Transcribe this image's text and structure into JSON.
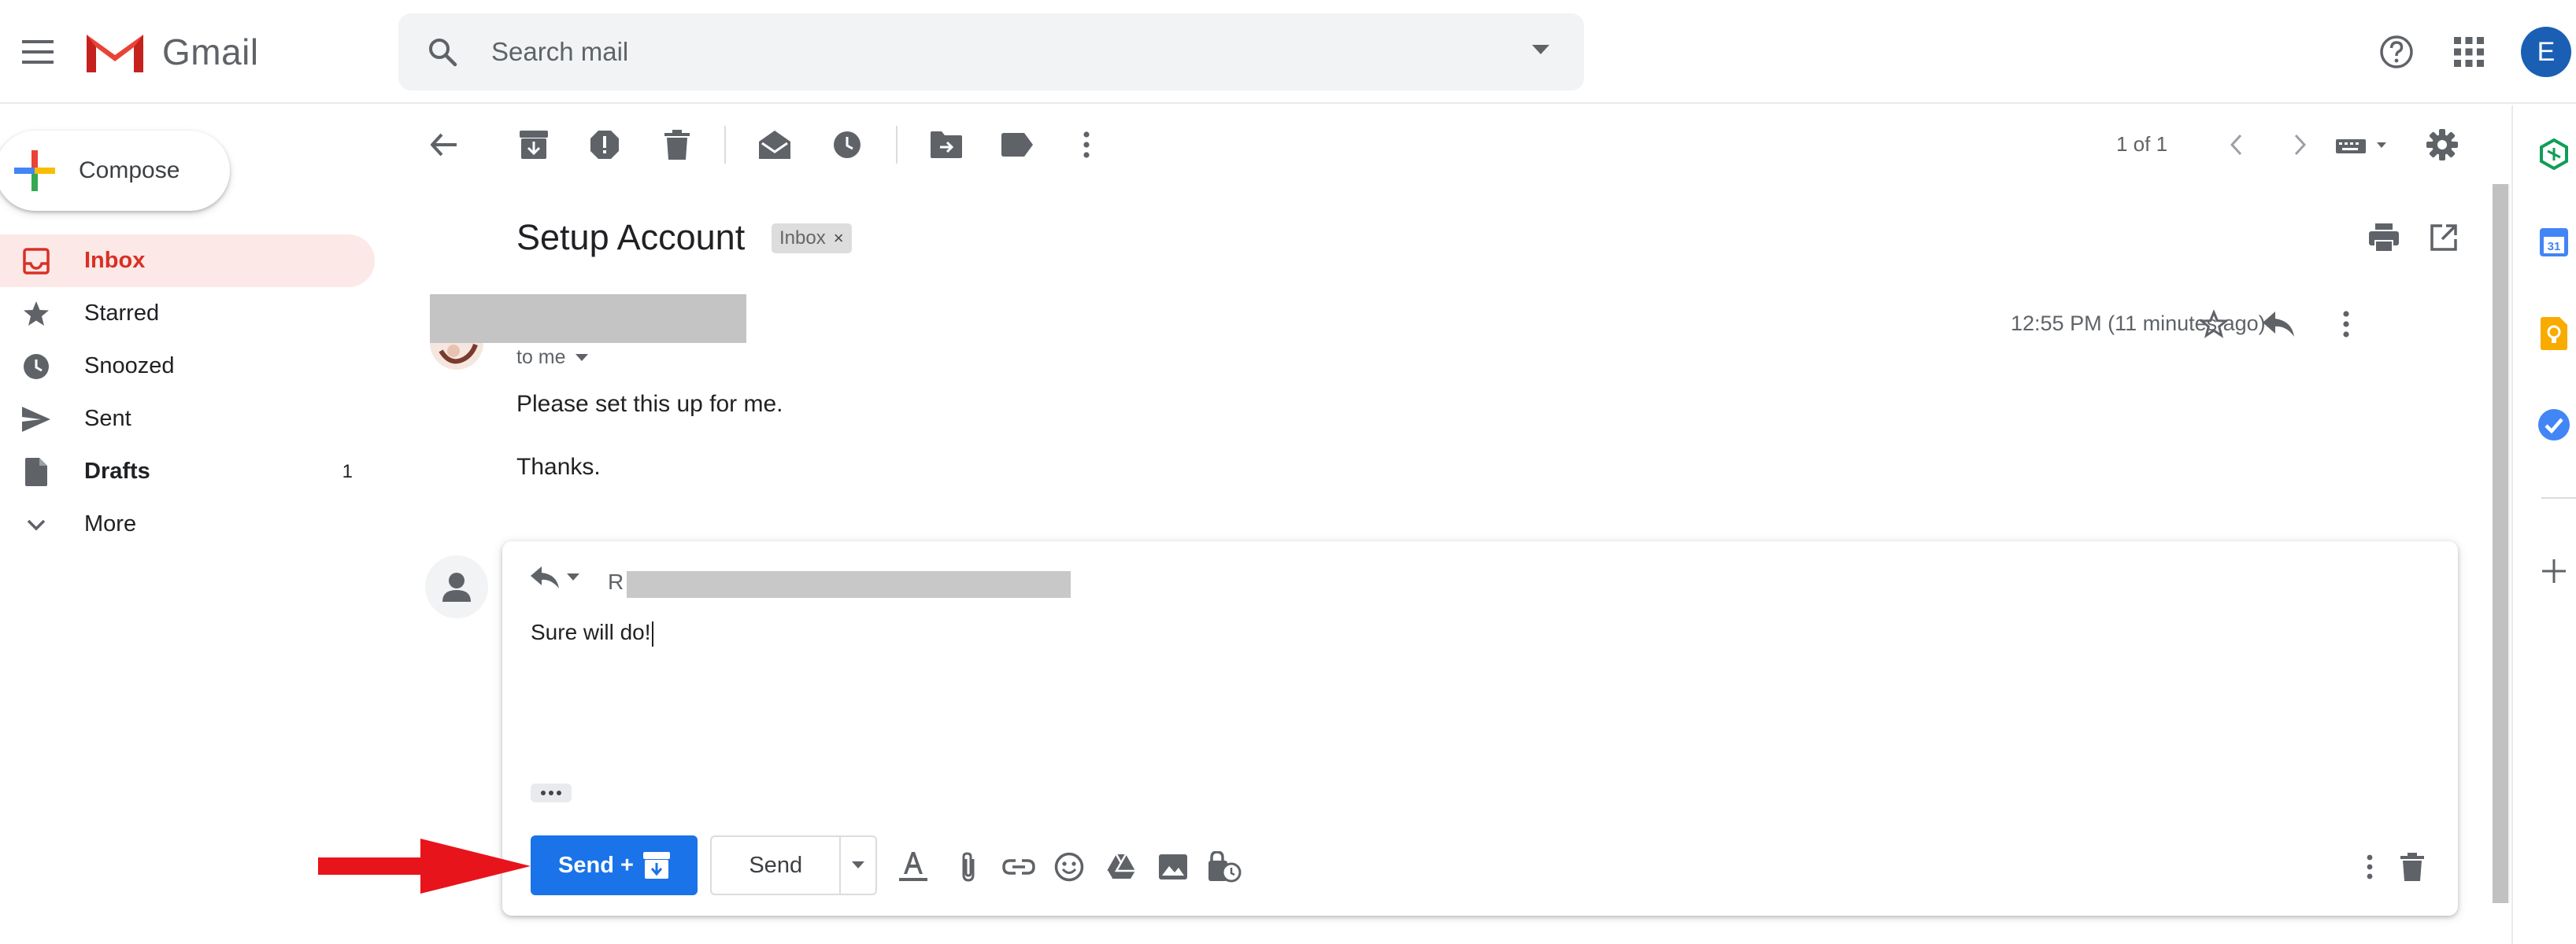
{
  "app": {
    "name": "Gmail",
    "avatar_letter": "E",
    "brand_colors": {
      "gmail_red": "#EA4335",
      "accent_blue": "#1A73E8",
      "active_nav_bg": "#FCE8E6",
      "active_nav_text": "#D93025"
    }
  },
  "header": {
    "search_placeholder": "Search mail",
    "icons": [
      "main-menu-icon",
      "search-icon",
      "search-options-icon",
      "help-icon",
      "apps-icon"
    ]
  },
  "compose": {
    "label": "Compose"
  },
  "sidebar": {
    "items": [
      {
        "label": "Inbox",
        "icon": "inbox-icon",
        "active": true,
        "count": ""
      },
      {
        "label": "Starred",
        "icon": "star-icon",
        "active": false,
        "count": ""
      },
      {
        "label": "Snoozed",
        "icon": "clock-icon",
        "active": false,
        "count": ""
      },
      {
        "label": "Sent",
        "icon": "send-icon",
        "active": false,
        "count": ""
      },
      {
        "label": "Drafts",
        "icon": "draft-icon",
        "active": false,
        "count": "1"
      },
      {
        "label": "More",
        "icon": "chevron-down-icon",
        "active": false,
        "count": ""
      }
    ]
  },
  "toolbar": {
    "page_count": "1 of 1",
    "icons": [
      "back-arrow-icon",
      "archive-icon",
      "report-spam-icon",
      "delete-icon",
      "mark-unread-icon",
      "snooze-icon",
      "move-to-icon",
      "label-icon",
      "more-vert-icon",
      "older-icon",
      "newer-icon",
      "input-tools-icon",
      "settings-icon"
    ]
  },
  "message": {
    "subject": "Setup Account",
    "label_chip": "Inbox",
    "label_chip_remove": "×",
    "recipient_line": "to me",
    "time": "12:55 PM (11 minutes ago)",
    "body": [
      "Please set this up for me.",
      "Thanks."
    ],
    "header_icons": [
      "print-icon",
      "open-in-new-window-icon",
      "star-icon",
      "reply-icon",
      "more-vert-icon"
    ]
  },
  "reply": {
    "recipient_initial": "R",
    "text": "Sure will do!",
    "send_archive_label": "Send +",
    "send_label": "Send",
    "formatting_icons": [
      "formatting-options-icon",
      "attach-files-icon",
      "insert-link-icon",
      "insert-emoji-icon",
      "insert-from-drive-icon",
      "insert-photo-icon",
      "confidential-mode-icon",
      "more-options-icon",
      "discard-draft-icon"
    ]
  },
  "side_panel": {
    "icons": [
      "sheets-addon-icon",
      "calendar-icon",
      "keep-icon",
      "tasks-icon",
      "get-addons-icon"
    ]
  },
  "annotation": {
    "arrow_color": "#E8141B"
  }
}
